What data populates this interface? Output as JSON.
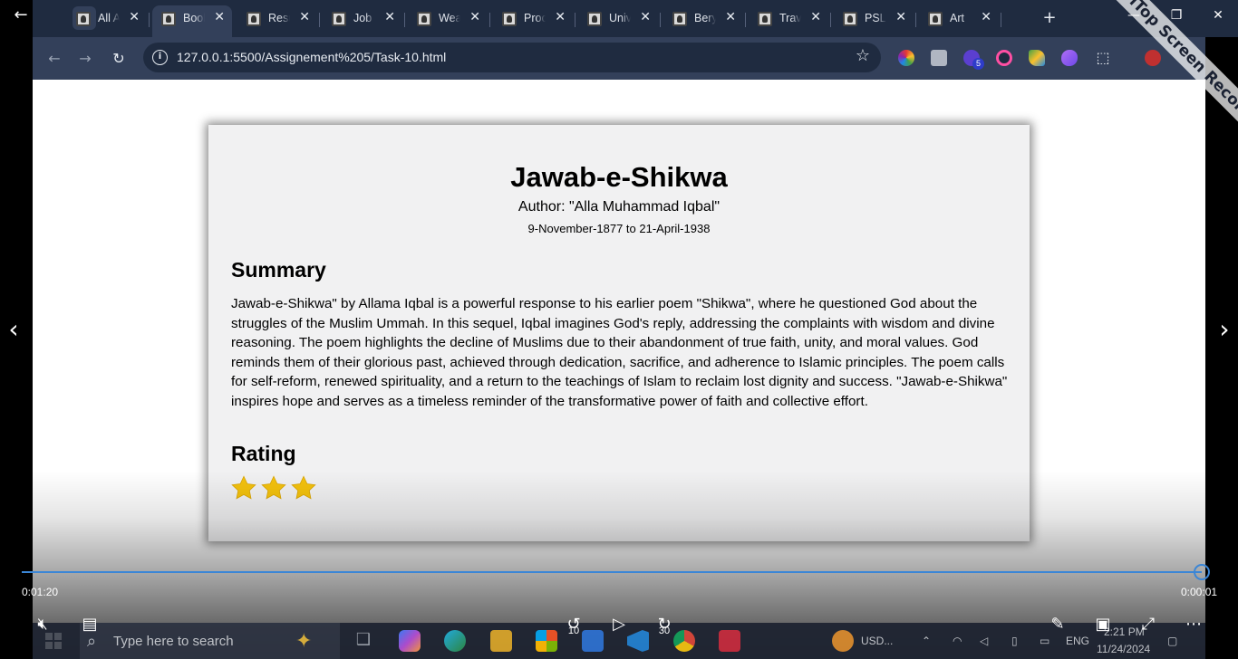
{
  "browser": {
    "tabs": [
      {
        "label": "All A",
        "active": false
      },
      {
        "label": "Book",
        "active": true
      },
      {
        "label": "Resu",
        "active": false
      },
      {
        "label": "Job",
        "active": false
      },
      {
        "label": "Wea",
        "active": false
      },
      {
        "label": "Proc",
        "active": false
      },
      {
        "label": "Univ",
        "active": false
      },
      {
        "label": "Bery",
        "active": false
      },
      {
        "label": "Trav",
        "active": false
      },
      {
        "label": "PSL",
        "active": false
      },
      {
        "label": "Art",
        "active": false
      }
    ],
    "close_glyph": "✕",
    "new_tab_glyph": "+",
    "url": "127.0.0.1:5500/Assignement%205/Task-10.html",
    "extension_badge": "5",
    "icons": [
      "back-arrow-icon",
      "forward-arrow-icon",
      "reload-icon",
      "site-info-icon",
      "star-icon",
      "extensions-icon",
      "profile-avatar-icon",
      "kebab-menu-icon"
    ]
  },
  "page": {
    "title": "Jawab-e-Shikwa",
    "author": "Author: \"Alla Muhammad Iqbal\"",
    "dates": "9-November-1877 to 21-April-1938",
    "summary_heading": "Summary",
    "summary_text": "Jawab-e-Shikwa\" by Allama Iqbal is a powerful response to his earlier poem \"Shikwa\", where he questioned God about the struggles of the Muslim Ummah. In this sequel, Iqbal imagines God's reply, addressing the complaints with wisdom and divine reasoning. The poem highlights the decline of Muslims due to their abandonment of true faith, unity, and moral values. God reminds them of their glorious past, achieved through dedication, sacrifice, and adherence to Islamic principles. The poem calls for self-reform, renewed spirituality, and a return to the teachings of Islam to reclaim lost dignity and success. \"Jawab-e-Shikwa\" inspires hope and serves as a timeless reminder of the transformative power of faith and collective effort.",
    "rating_heading": "Rating",
    "rating_stars": 3,
    "star_color": "#f4c20d"
  },
  "player": {
    "time_elapsed": "0:01:20",
    "time_remaining": "0:00:01",
    "skip_back_seconds": "10",
    "skip_forward_seconds": "30",
    "progress": 1.0,
    "accent_color": "#3b86d6"
  },
  "taskbar": {
    "search_placeholder": "Type here to search",
    "stock_ticker": "USD...",
    "language": "ENG",
    "time": "2:21 PM",
    "date": "11/24/2024"
  },
  "watermark": {
    "text": "iTop Screen Recorder"
  }
}
